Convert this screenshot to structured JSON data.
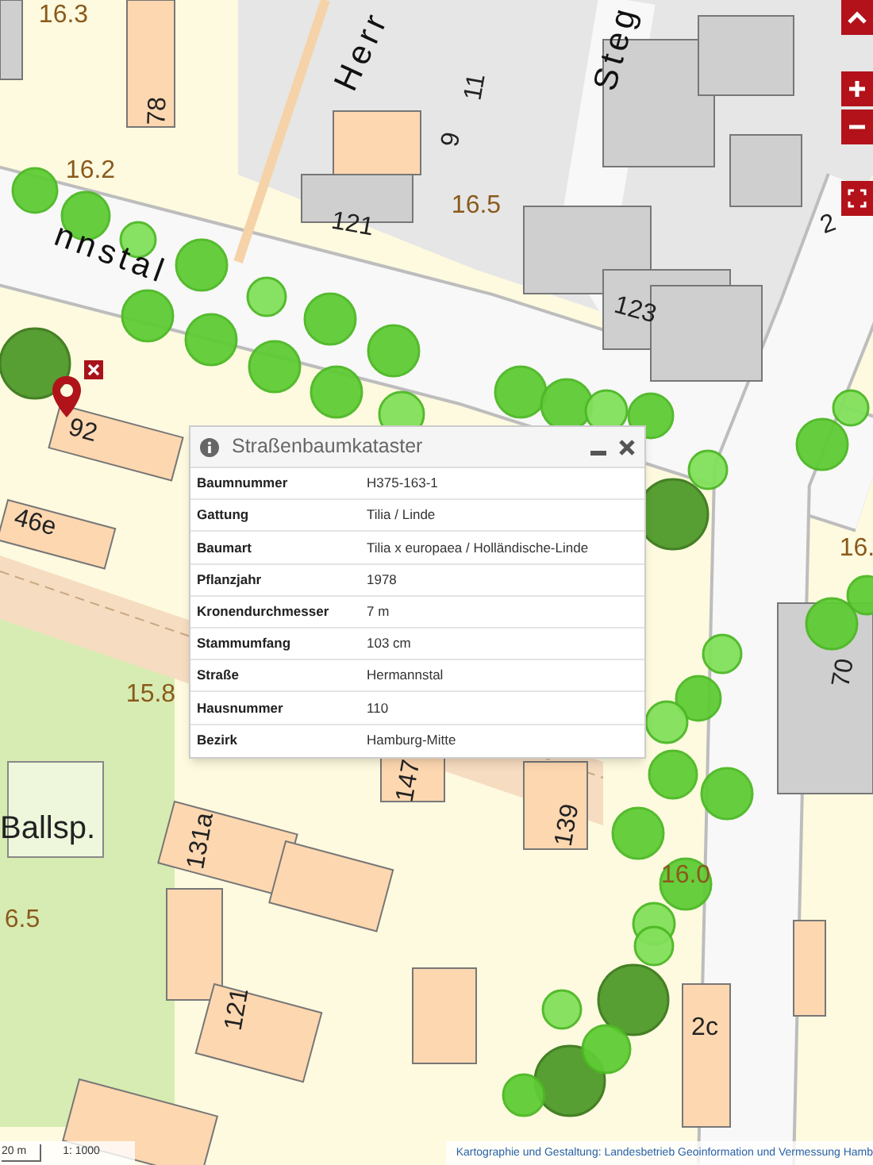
{
  "map": {
    "labels": [
      {
        "text": "16.3",
        "kind": "height"
      },
      {
        "text": "78",
        "kind": "house"
      },
      {
        "text": "Herr",
        "kind": "street"
      },
      {
        "text": "Steg",
        "kind": "street"
      },
      {
        "text": "11",
        "kind": "house"
      },
      {
        "text": "9",
        "kind": "house"
      },
      {
        "text": "16.2",
        "kind": "height"
      },
      {
        "text": "121",
        "kind": "house"
      },
      {
        "text": "16.5",
        "kind": "height"
      },
      {
        "text": "nnstal",
        "kind": "street"
      },
      {
        "text": "123",
        "kind": "house"
      },
      {
        "text": "2",
        "kind": "house"
      },
      {
        "text": "92",
        "kind": "house"
      },
      {
        "text": "46e",
        "kind": "house"
      },
      {
        "text": "16.",
        "kind": "height"
      },
      {
        "text": "70",
        "kind": "house"
      },
      {
        "text": "15.8",
        "kind": "height"
      },
      {
        "text": "Ballsp.",
        "kind": "place"
      },
      {
        "text": "147",
        "kind": "house"
      },
      {
        "text": "139",
        "kind": "house"
      },
      {
        "text": "131a",
        "kind": "house"
      },
      {
        "text": "16.0",
        "kind": "height"
      },
      {
        "text": "6.5",
        "kind": "height"
      },
      {
        "text": "121",
        "kind": "house"
      },
      {
        "text": "2c",
        "kind": "house"
      }
    ]
  },
  "popup": {
    "title": "Straßenbaumkataster",
    "rows": [
      {
        "label": "Baumnummer",
        "value": "H375-163-1"
      },
      {
        "label": "Gattung",
        "value": "Tilia / Linde"
      },
      {
        "label": "Baumart",
        "value": "Tilia x europaea / Holländische-Linde"
      },
      {
        "label": "Pflanzjahr",
        "value": "1978"
      },
      {
        "label": "Kronendurchmesser",
        "value": "7 m"
      },
      {
        "label": "Stammumfang",
        "value": "103 cm"
      },
      {
        "label": "Straße",
        "value": "Hermannstal"
      },
      {
        "label": "Hausnummer",
        "value": "110"
      },
      {
        "label": "Bezirk",
        "value": "Hamburg-Mitte"
      }
    ]
  },
  "footer": {
    "scale": "20 m",
    "ratio": "1: 1000",
    "attribution": "Kartographie und Gestaltung: Landesbetrieb Geoinformation und Vermessung Hamb"
  }
}
